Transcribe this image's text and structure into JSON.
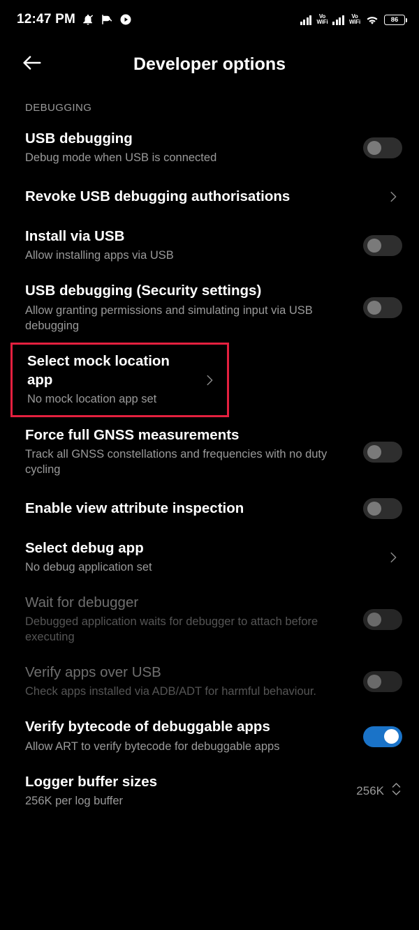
{
  "statusbar": {
    "time": "12:47 PM",
    "left_icons": [
      "bell-muted-icon",
      "data-saver-icon",
      "play-circle-icon"
    ],
    "right_icons": [
      "signal-bars-icon",
      "vowifi-label",
      "signal-bars-icon",
      "vowifi-label",
      "wifi-icon",
      "battery-icon"
    ],
    "vowifi_top": "Vo",
    "vowifi_bottom": "WiFi",
    "battery_level": "86"
  },
  "appbar": {
    "back_icon": "back-arrow-icon",
    "title": "Developer options"
  },
  "section": {
    "label": "DEBUGGING"
  },
  "colors": {
    "background": "#000000",
    "title_text": "#ffffff",
    "subtitle_text": "#9a9a9a",
    "disabled_text": "#6e6e6e",
    "toggle_on": "#1a73c8",
    "toggle_off_track": "#2e2e2e",
    "highlight_border": "#e4203f"
  },
  "rows": [
    {
      "title": "USB debugging",
      "subtitle": "Debug mode when USB is connected",
      "control": "toggle",
      "toggle_state": "off",
      "disabled": false,
      "highlighted": false
    },
    {
      "title": "Revoke USB debugging authorisations",
      "subtitle": "",
      "control": "chevron",
      "toggle_state": "",
      "disabled": false,
      "highlighted": false
    },
    {
      "title": "Install via USB",
      "subtitle": "Allow installing apps via USB",
      "control": "toggle",
      "toggle_state": "off",
      "disabled": false,
      "highlighted": false
    },
    {
      "title": "USB debugging (Security settings)",
      "subtitle": "Allow granting permissions and simulating input via USB debugging",
      "control": "toggle",
      "toggle_state": "off",
      "disabled": false,
      "highlighted": false
    },
    {
      "title": "Select mock location app",
      "subtitle": "No mock location app set",
      "control": "chevron",
      "toggle_state": "",
      "disabled": false,
      "highlighted": true
    },
    {
      "title": "Force full GNSS measurements",
      "subtitle": "Track all GNSS constellations and frequencies with no duty cycling",
      "control": "toggle",
      "toggle_state": "off",
      "disabled": false,
      "highlighted": false
    },
    {
      "title": "Enable view attribute inspection",
      "subtitle": "",
      "control": "toggle",
      "toggle_state": "off",
      "disabled": false,
      "highlighted": false
    },
    {
      "title": "Select debug app",
      "subtitle": "No debug application set",
      "control": "chevron",
      "toggle_state": "",
      "disabled": false,
      "highlighted": false
    },
    {
      "title": "Wait for debugger",
      "subtitle": "Debugged application waits for debugger to attach before executing",
      "control": "toggle",
      "toggle_state": "off",
      "disabled": true,
      "highlighted": false
    },
    {
      "title": "Verify apps over USB",
      "subtitle": "Check apps installed via ADB/ADT for harmful behaviour.",
      "control": "toggle",
      "toggle_state": "off",
      "disabled": true,
      "highlighted": false
    },
    {
      "title": "Verify bytecode of debuggable apps",
      "subtitle": "Allow ART to verify bytecode for debuggable apps",
      "control": "toggle",
      "toggle_state": "on",
      "disabled": false,
      "highlighted": false
    },
    {
      "title": "Logger buffer sizes",
      "subtitle": "256K per log buffer",
      "control": "value",
      "value": "256K",
      "toggle_state": "",
      "disabled": false,
      "highlighted": false
    }
  ]
}
